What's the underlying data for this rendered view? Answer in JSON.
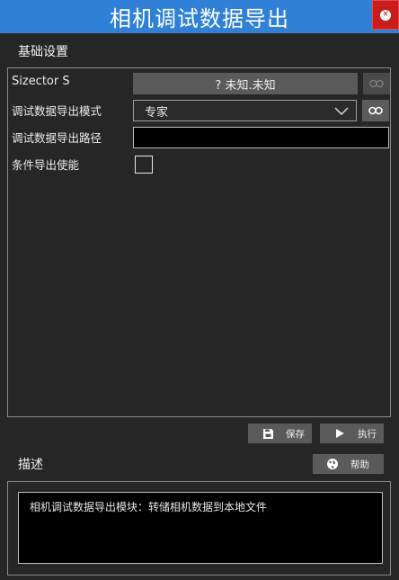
{
  "window": {
    "title": "相机调试数据导出"
  },
  "sections": {
    "basic": "基础设置",
    "description": "描述"
  },
  "rows": {
    "device_label": "Sizector S",
    "device_value": "? 未知.未知",
    "mode_label": "调试数据导出模式",
    "mode_value": "专家",
    "path_label": "调试数据导出路径",
    "path_value": "",
    "enable_label": "条件导出使能"
  },
  "buttons": {
    "save": "保存",
    "execute": "执行",
    "help": "帮助"
  },
  "description_text": "相机调试数据导出模块：转储相机数据到本地文件",
  "colors": {
    "title_bar": "#2f80d6",
    "close": "#c81d1d",
    "background": "#262626"
  }
}
